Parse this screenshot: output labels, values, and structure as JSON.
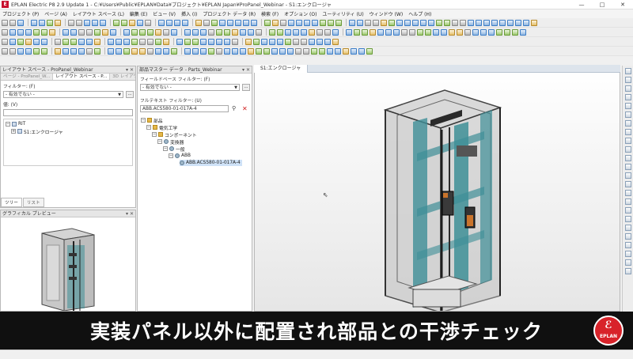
{
  "window": {
    "app_logo": "E",
    "title": "EPLAN Electric P8 2.9 Update 1 - C:¥Users¥Public¥EPLAN¥Data¥プロジェクト¥EPLAN Japan¥ProPanel_Webinar - S1:エンクロージャ",
    "controls": {
      "minimize": "—",
      "maximize": "□",
      "close": "✕"
    }
  },
  "menu": [
    "プロジェクト (P)",
    "ページ (A)",
    "レイアウト スペース (L)",
    "編集 (E)",
    "ビュー (V)",
    "挿入 (I)",
    "プロジェクト データ (R)",
    "検索 (F)",
    "オプション (O)",
    "ユーティリティ (U)",
    "ウィンドウ (W)",
    "ヘルプ (H)"
  ],
  "layout_panel": {
    "title": "レイアウト スペース - ProPanel_Webinar",
    "tabs": [
      "ページ - ProPanel_W...",
      "レイアウト スペース - P...",
      "3D レイアウト スペース - ProP..."
    ],
    "filter_label": "フィルター: (F)",
    "filter_value": "- 有効でない -",
    "value_label": "値: (V)",
    "tree": [
      {
        "label": "RIT",
        "expander": "−"
      },
      {
        "label": "S1:エンクロージャ",
        "expander": "+"
      }
    ],
    "bottom_tabs": [
      "ツリー",
      "リスト"
    ]
  },
  "preview_panel": {
    "title": "グラフィカル プレビュー"
  },
  "parts_panel": {
    "title": "部品マスター データ - Parts_Webinar",
    "field_filter_label": "フィールドベース フィルター: (F)",
    "field_filter_value": "- 有効でない -",
    "fulltext_label": "フルテキスト フィルター: (U)",
    "fulltext_value": "ABB.ACS580-01-017A-4",
    "tree": [
      {
        "label": "部品",
        "expander": "−"
      },
      {
        "label": "電気工学",
        "expander": "−"
      },
      {
        "label": "コンポーネント",
        "expander": "−"
      },
      {
        "label": "変換器",
        "expander": "−"
      },
      {
        "label": "一般",
        "expander": "−"
      },
      {
        "label": "ABB",
        "expander": "−"
      },
      {
        "label": "ABB.ACS580-01-017A-4",
        "expander": ""
      }
    ]
  },
  "viewport": {
    "tab": "S1:エンクロージャ"
  },
  "caption": {
    "text": "実装パネル以外に配置され部品との干渉チェック"
  },
  "badge": {
    "symbol": "ℰ",
    "label": "EPLAN"
  },
  "colors": {
    "brand_red": "#c8102e",
    "caption_bg": "#101010",
    "enclosure_teal": "#3e8f97"
  },
  "icons": [
    "application-logo-icon",
    "delete-filter-icon",
    "search-filter-icon",
    "folder-icon",
    "part-icon",
    "cursor-icon"
  ]
}
